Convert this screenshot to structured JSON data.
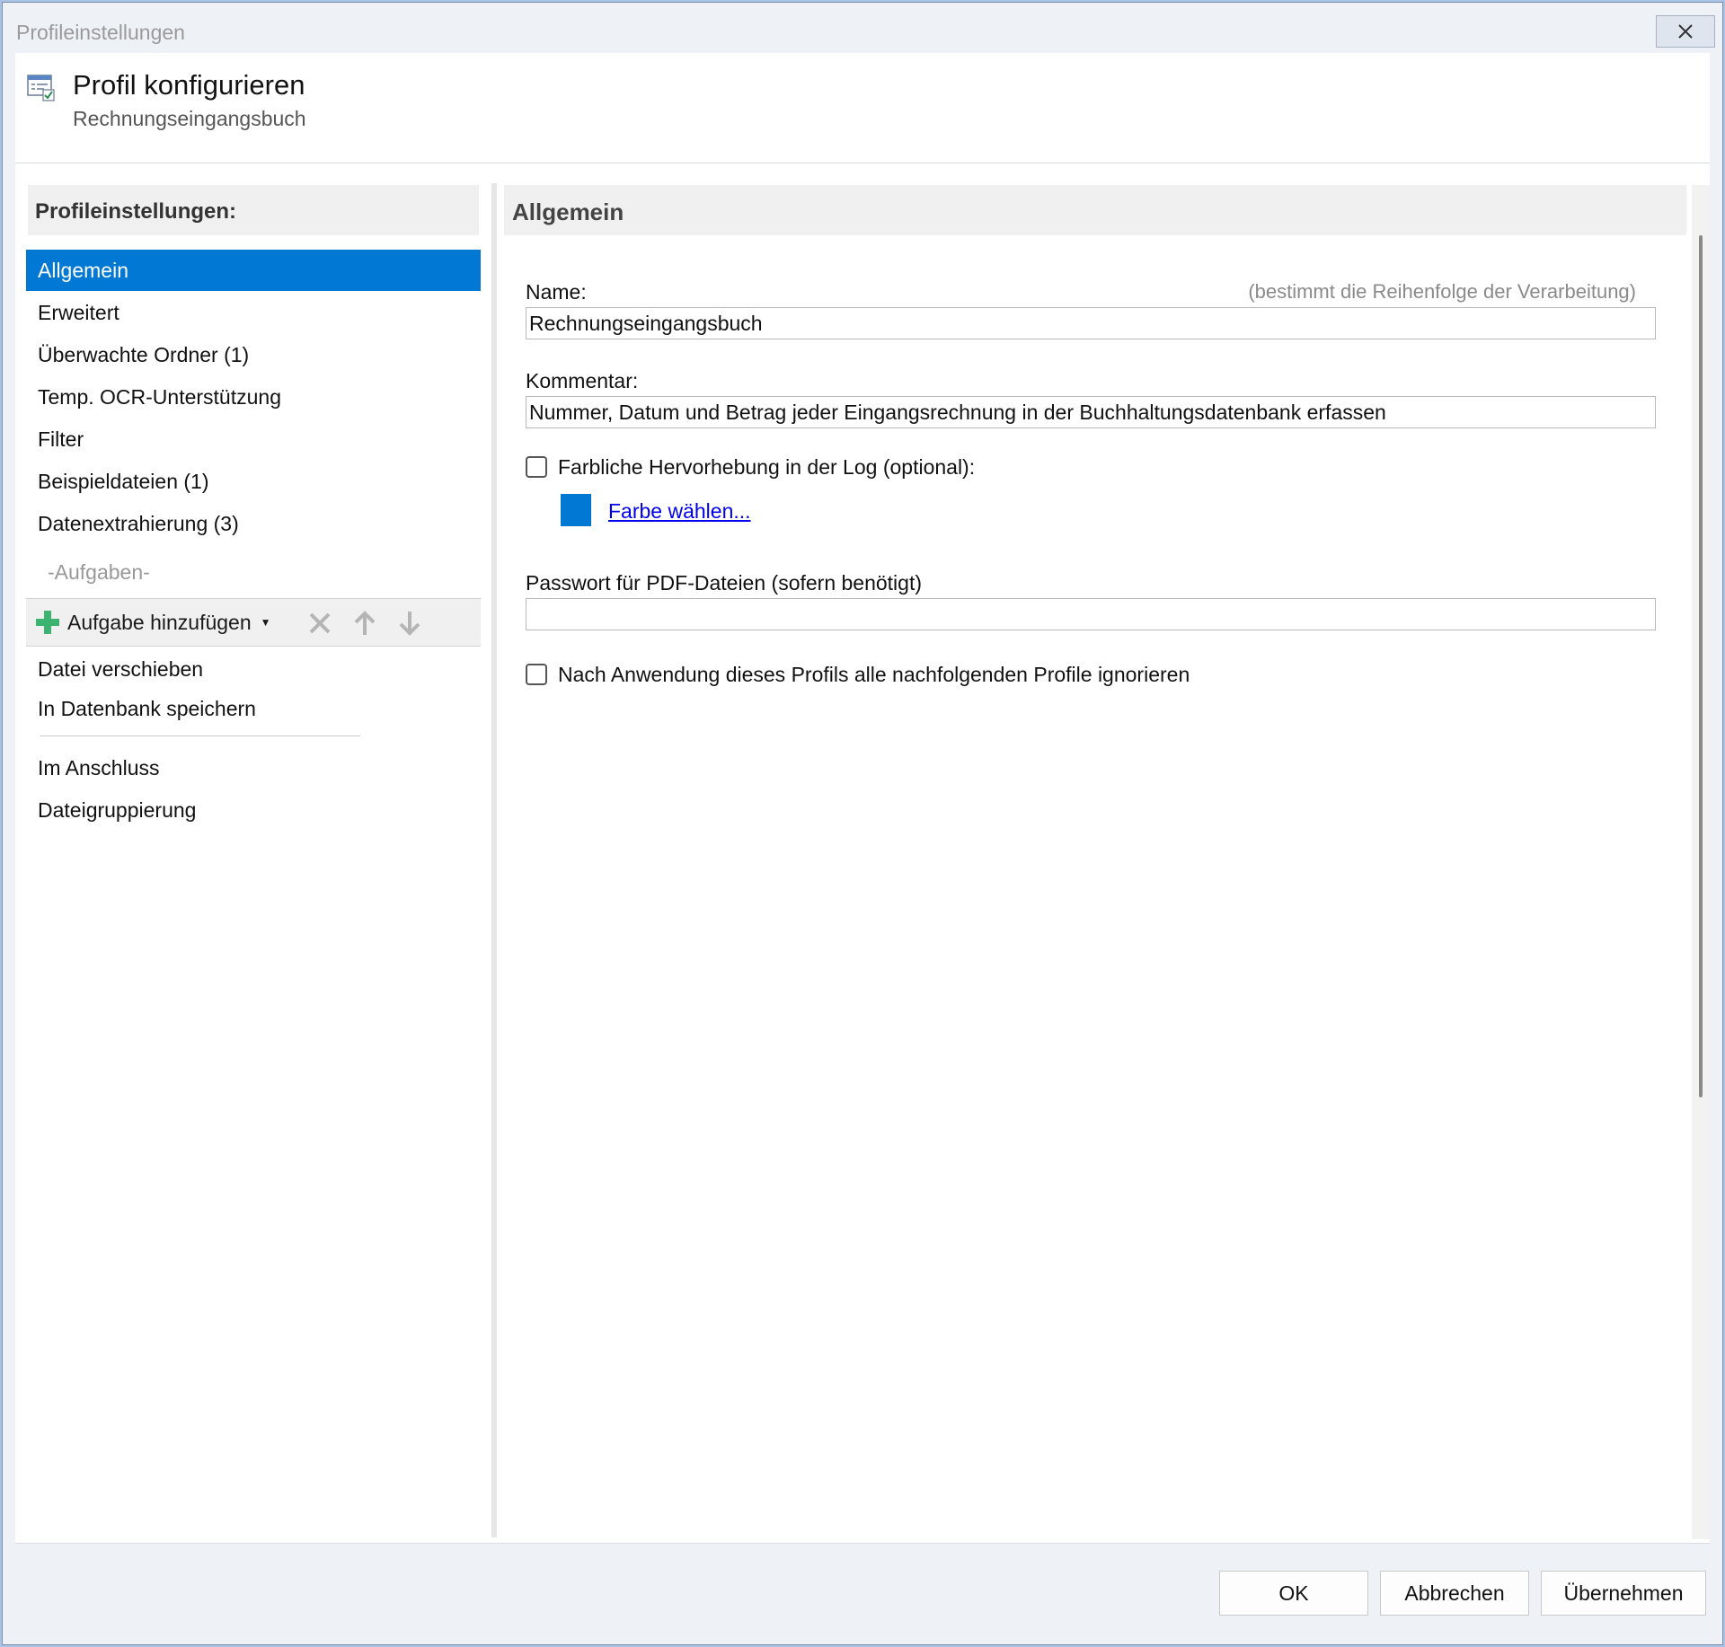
{
  "window": {
    "title": "Profileinstellungen"
  },
  "header": {
    "title": "Profil konfigurieren",
    "subtitle": "Rechnungseingangsbuch"
  },
  "left": {
    "header": "Profileinstellungen:",
    "items": [
      {
        "label": "Allgemein",
        "selected": true
      },
      {
        "label": "Erweitert"
      },
      {
        "label": "Überwachte Ordner (1)"
      },
      {
        "label": "Temp. OCR-Unterstützung"
      },
      {
        "label": "Filter"
      },
      {
        "label": "Beispieldateien (1)"
      },
      {
        "label": "Datenextrahierung (3)"
      }
    ],
    "tasks_label": "-Aufgaben-",
    "toolbar": {
      "add_label": "Aufgabe hinzufügen"
    },
    "tasks": [
      {
        "label": "Datei verschieben"
      },
      {
        "label": "In Datenbank speichern"
      }
    ],
    "after": [
      {
        "label": "Im Anschluss"
      },
      {
        "label": "Dateigruppierung"
      }
    ]
  },
  "main": {
    "header": "Allgemein",
    "name_label": "Name:",
    "name_hint": "(bestimmt die Reihenfolge der Verarbeitung)",
    "name_value": "Rechnungseingangsbuch",
    "comment_label": "Kommentar:",
    "comment_value": "Nummer, Datum und Betrag jeder Eingangsrechnung in der Buchhaltungsdatenbank erfassen",
    "highlight_label": "Farbliche Hervorhebung in der Log (optional):",
    "highlight_checked": false,
    "color_swatch": "#0078d4",
    "color_link": "Farbe wählen...",
    "password_label": "Passwort für PDF-Dateien (sofern benötigt)",
    "password_value": "",
    "ignore_label": "Nach Anwendung dieses Profils alle nachfolgenden Profile ignorieren",
    "ignore_checked": false
  },
  "footer": {
    "ok": "OK",
    "cancel": "Abbrechen",
    "apply": "Übernehmen"
  },
  "colors": {
    "accent": "#0078d4",
    "add_icon": "#3cb371"
  }
}
